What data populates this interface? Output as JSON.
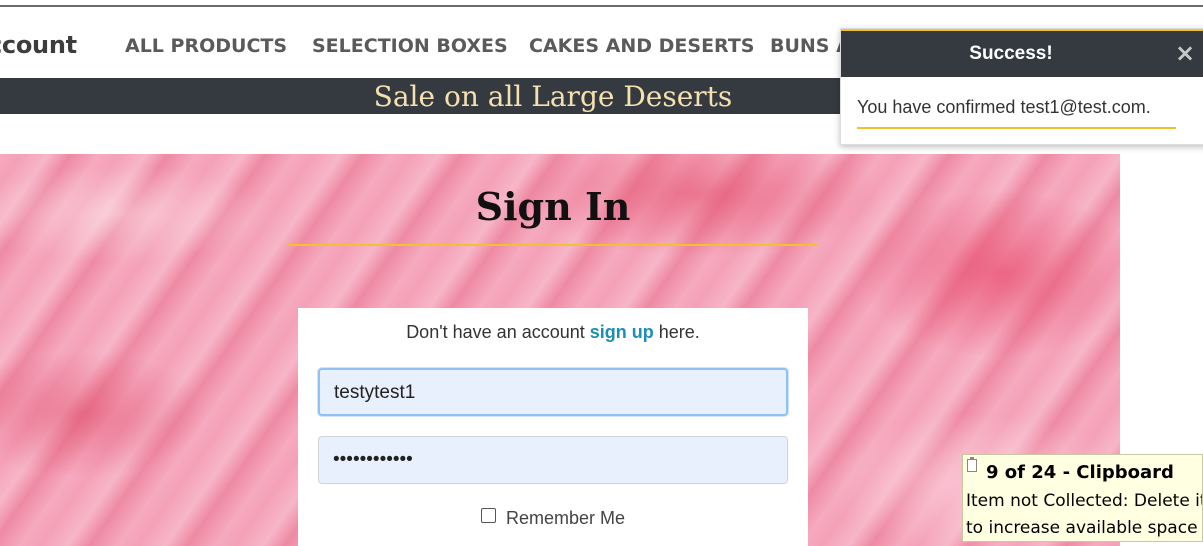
{
  "nav": {
    "brand": "ccount",
    "links": [
      "ALL PRODUCTS",
      "SELECTION BOXES",
      "CAKES AND DESERTS",
      "BUNS A"
    ]
  },
  "banner": {
    "text": "Sale on all Large Deserts"
  },
  "signin": {
    "title": "Sign In",
    "prompt_before": "Don't have an account",
    "prompt_link": "sign up",
    "prompt_after": "here.",
    "username_value": "testytest1",
    "password_value": "••••••••••••",
    "remember_label": "Remember Me",
    "remember_checked": false
  },
  "toast": {
    "title": "Success!",
    "close_icon": "×",
    "message": "You have confirmed test1@test.com."
  },
  "clipboard": {
    "title": "9 of 24 - Clipboard",
    "line1": "Item not Collected: Delete it",
    "line2": "to increase available space"
  },
  "colors": {
    "dark": "#343a40",
    "accent_gold": "#f2c12e",
    "link": "#1b8fb5",
    "hero_pink": "#f4a6bb"
  }
}
